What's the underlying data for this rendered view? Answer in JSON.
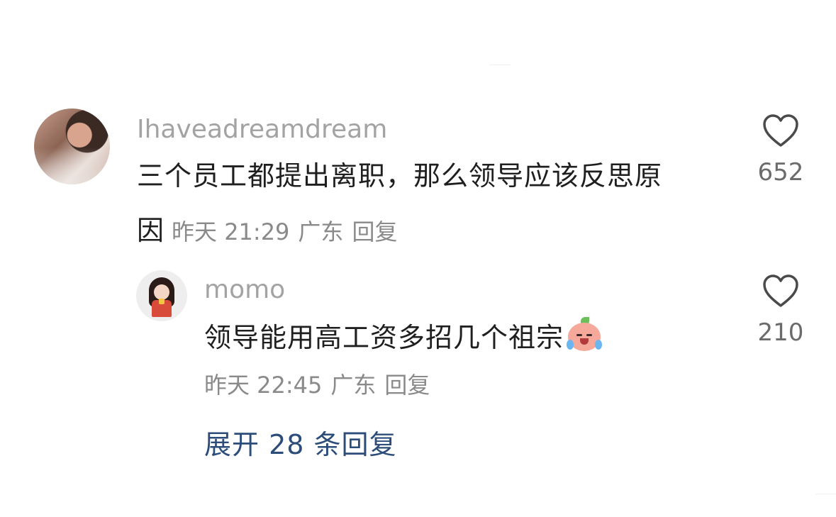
{
  "comment": {
    "username": "Ihaveadreamdream",
    "text_line1": "三个员工都提出离职，那么领导应该反思原",
    "text_line2": "因",
    "time": "昨天 21:29",
    "location": "广东",
    "reply_label": "回复",
    "like_count": "652"
  },
  "reply": {
    "username": "momo",
    "text": "领导能用高工资多招几个祖宗",
    "emoji": "crying-laughing-emoji",
    "time": "昨天 22:45",
    "location": "广东",
    "reply_label": "回复",
    "like_count": "210"
  },
  "expand_replies": "展开 28 条回复",
  "colors": {
    "username": "#a3a3a3",
    "body": "#1f1f1f",
    "meta": "#8a8a8a",
    "expand": "#2c4d7a"
  }
}
